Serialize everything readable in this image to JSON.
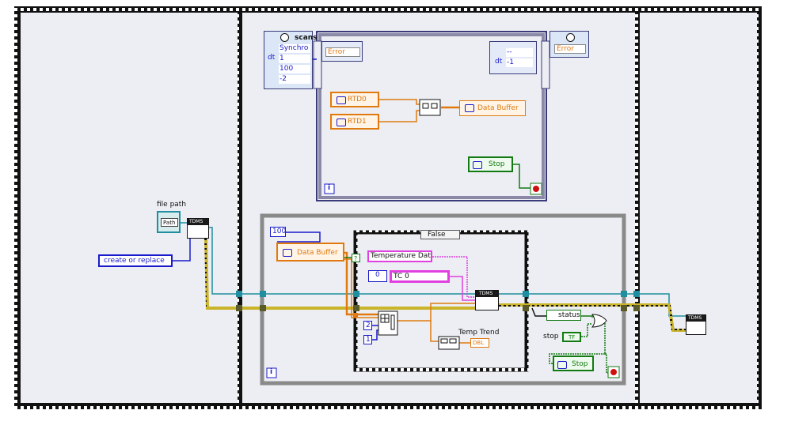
{
  "colors": {
    "frame_bg": "#eceef3",
    "filmstrip": "#111111",
    "wire_dynamic": "#1f8ea0",
    "wire_error": "#c9b42a",
    "wire_orange": "#e07a10",
    "wire_string": "#e040e0",
    "wire_green": "#137a13",
    "wire_blue": "#1a1acc",
    "loop_border": "#8a8a8a",
    "timed_loop_border": "#3a3a7a"
  },
  "icons": {
    "timed_loop_node": "clock-icon",
    "tdms_open": "tdms-open-icon",
    "tdms_write": "tdms-write-icon",
    "tdms_close": "tdms-close-icon",
    "loop_iteration": "iteration-terminal-icon",
    "loop_stop": "stop-terminal-icon",
    "shared_variable": "shared-variable-icon"
  },
  "labels": {
    "scans": "scans",
    "file_path": "file path",
    "temp_trend": "Temp Trend",
    "stop": "stop",
    "iteration": "i",
    "iteration2": "i"
  },
  "timed_loop_input": {
    "row1": "Synchro",
    "row2": "1",
    "row3": "100",
    "row4": "-2",
    "tag_dt": "dt"
  },
  "timed_loop": {
    "error_in": "Error",
    "error_out": "Error",
    "out_row1": "--",
    "out_row2": "-1",
    "tag_dt": "dt"
  },
  "variables": {
    "rtd0": "RTD0",
    "rtd1": "RTD1",
    "data_buffer_write": "Data Buffer",
    "stop_read": "Stop",
    "data_buffer_read": "Data Buffer",
    "status": "status",
    "stop_write": "Stop"
  },
  "file_io": {
    "path_control": "Path",
    "open_mode": "create or replace",
    "tdms_tag_open": "TDMS",
    "tdms_tag_write": "TDMS",
    "tdms_tag_close": "TDMS"
  },
  "constants": {
    "loop_wait": "100",
    "index_2": "2",
    "index_1": "1",
    "group_name": "Temperature Data",
    "channel_index": "0",
    "channel_name": "TC 0",
    "dbl_tag": "DBL",
    "tf_tag": "TF",
    "question_tag": "?"
  },
  "case_structure": {
    "selector": "False"
  }
}
